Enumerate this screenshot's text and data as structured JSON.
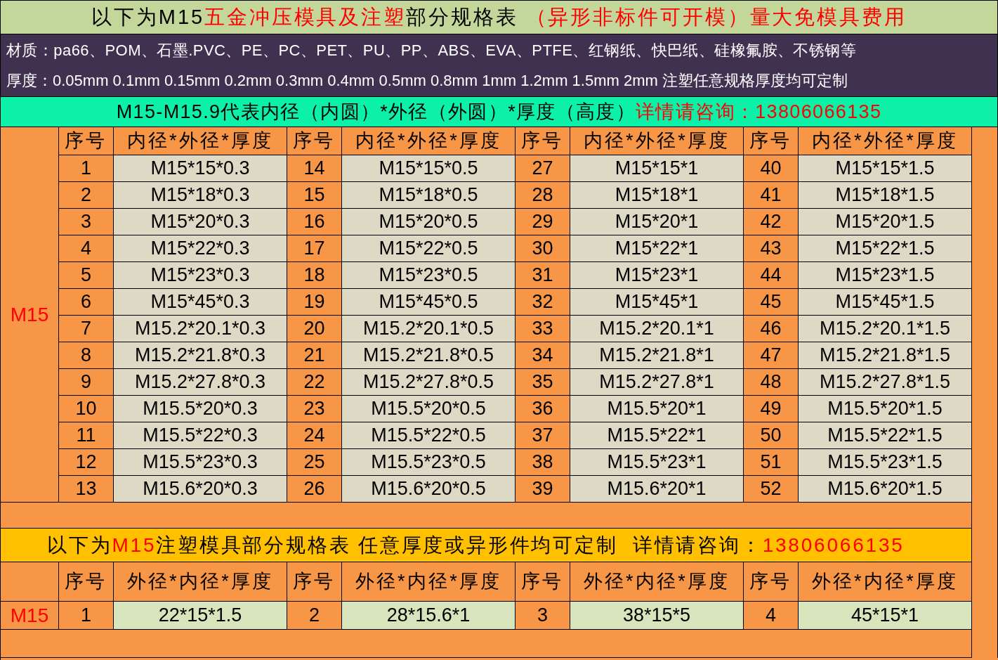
{
  "title": [
    {
      "text": "以下为M15",
      "highlight": false
    },
    {
      "text": "五金冲压模具及注塑",
      "highlight": true
    },
    {
      "text": "部分规格表 ",
      "highlight": false
    },
    {
      "text": "（异形非标件可开模）量大免模具费用",
      "highlight": true
    }
  ],
  "materials": "材质：pa66、POM、石墨.PVC、PE、PC、PET、PU、PP、ABS、EVA、PTFE、红钢纸、快巴纸、硅橡氟胺、不锈钢等",
  "thickness": "厚度：0.05mm 0.1mm 0.15mm 0.2mm 0.3mm 0.4mm 0.5mm 0.8mm 1mm 1.2mm 1.5mm 2mm 注塑任意规格厚度均可定制",
  "note": [
    {
      "text": "M15-M15.9代表内径（内圆）*外径（外圆）*厚度（高度）",
      "highlight": false
    },
    {
      "text": "详情请咨询：13806066135",
      "highlight": true
    }
  ],
  "section1": {
    "row_label": "M15",
    "headers": [
      "序号",
      "内径*外径*厚度",
      "序号",
      "内径*外径*厚度",
      "序号",
      "内径*外径*厚度",
      "序号",
      "内径*外径*厚度"
    ],
    "rows": [
      [
        "1",
        "M15*15*0.3",
        "14",
        "M15*15*0.5",
        "27",
        "M15*15*1",
        "40",
        "M15*15*1.5"
      ],
      [
        "2",
        "M15*18*0.3",
        "15",
        "M15*18*0.5",
        "28",
        "M15*18*1",
        "41",
        "M15*18*1.5"
      ],
      [
        "3",
        "M15*20*0.3",
        "16",
        "M15*20*0.5",
        "29",
        "M15*20*1",
        "42",
        "M15*20*1.5"
      ],
      [
        "4",
        "M15*22*0.3",
        "17",
        "M15*22*0.5",
        "30",
        "M15*22*1",
        "43",
        "M15*22*1.5"
      ],
      [
        "5",
        "M15*23*0.3",
        "18",
        "M15*23*0.5",
        "31",
        "M15*23*1",
        "44",
        "M15*23*1.5"
      ],
      [
        "6",
        "M15*45*0.3",
        "19",
        "M15*45*0.5",
        "32",
        "M15*45*1",
        "45",
        "M15*45*1.5"
      ],
      [
        "7",
        "M15.2*20.1*0.3",
        "20",
        "M15.2*20.1*0.5",
        "33",
        "M15.2*20.1*1",
        "46",
        "M15.2*20.1*1.5"
      ],
      [
        "8",
        "M15.2*21.8*0.3",
        "21",
        "M15.2*21.8*0.5",
        "34",
        "M15.2*21.8*1",
        "47",
        "M15.2*21.8*1.5"
      ],
      [
        "9",
        "M15.2*27.8*0.3",
        "22",
        "M15.2*27.8*0.5",
        "35",
        "M15.2*27.8*1",
        "48",
        "M15.2*27.8*1.5"
      ],
      [
        "10",
        "M15.5*20*0.3",
        "23",
        "M15.5*20*0.5",
        "36",
        "M15.5*20*1",
        "49",
        "M15.5*20*1.5"
      ],
      [
        "11",
        "M15.5*22*0.3",
        "24",
        "M15.5*22*0.5",
        "37",
        "M15.5*22*1",
        "50",
        "M15.5*22*1.5"
      ],
      [
        "12",
        "M15.5*23*0.3",
        "25",
        "M15.5*23*0.5",
        "38",
        "M15.5*23*1",
        "51",
        "M15.5*23*1.5"
      ],
      [
        "13",
        "M15.6*20*0.3",
        "26",
        "M15.6*20*0.5",
        "39",
        "M15.6*20*1",
        "52",
        "M15.6*20*1.5"
      ]
    ]
  },
  "banner2": [
    {
      "text": "以下为",
      "highlight": false
    },
    {
      "text": "M15",
      "highlight": true
    },
    {
      "text": "注塑模具部分规格表 任意厚度或异形件均可定制  详情请咨询：",
      "highlight": false
    },
    {
      "text": "13806066135",
      "highlight": true
    }
  ],
  "section2": {
    "row_label": "M15",
    "headers": [
      "序号",
      "外径*内径*厚度",
      "序号",
      "外径*内径*厚度",
      "序号",
      "外径*内径*厚度",
      "序号",
      "外径*内径*厚度"
    ],
    "rows": [
      [
        "1",
        "22*15*1.5",
        "2",
        "28*15.6*1",
        "3",
        "38*15*5",
        "4",
        "45*15*1"
      ]
    ]
  }
}
